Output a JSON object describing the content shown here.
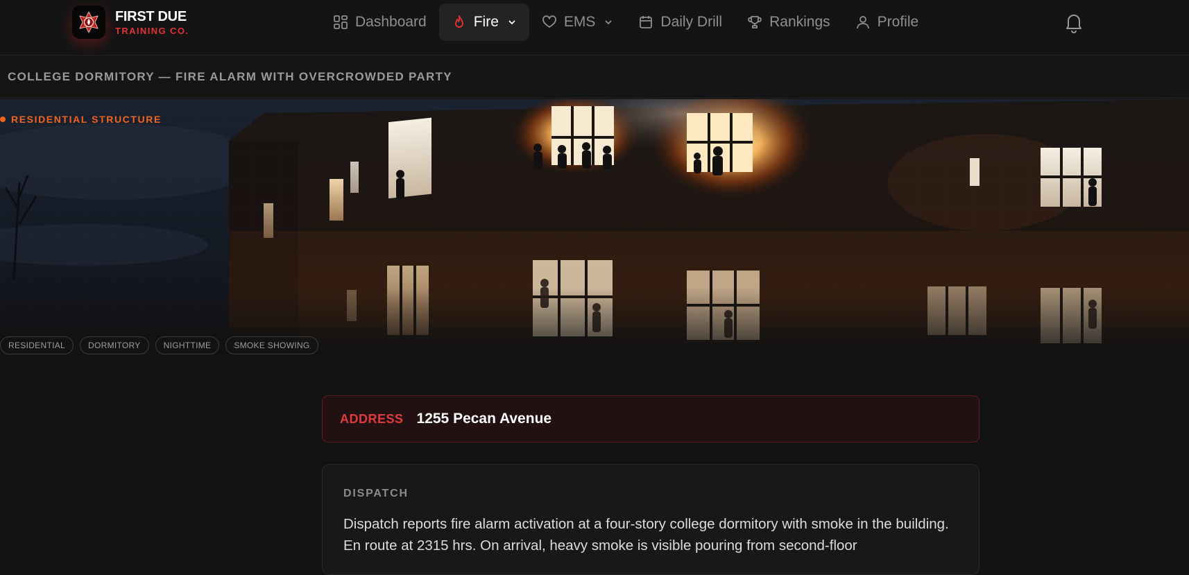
{
  "brand": {
    "line1": "FIRST DUE",
    "line2": "TRAINING CO."
  },
  "nav": [
    {
      "label": "Dashboard",
      "icon": "grid-icon",
      "active": false
    },
    {
      "label": "Fire",
      "icon": "flame-icon",
      "active": true,
      "dropdown": true
    },
    {
      "label": "EMS",
      "icon": "heart-icon",
      "active": false,
      "dropdown": true
    },
    {
      "label": "Daily Drill",
      "icon": "calendar-icon",
      "active": false
    },
    {
      "label": "Rankings",
      "icon": "trophy-icon",
      "active": false
    },
    {
      "label": "Profile",
      "icon": "user-icon",
      "active": false
    }
  ],
  "header": {
    "notifications_icon": "bell-icon"
  },
  "scenario": {
    "title": "COLLEGE DORMITORY — FIRE ALARM WITH OVERCROWDED PARTY",
    "category": "RESIDENTIAL STRUCTURE",
    "tags": [
      "RESIDENTIAL",
      "DORMITORY",
      "NIGHTTIME",
      "SMOKE SHOWING"
    ],
    "address_label": "ADDRESS",
    "address": "1255 Pecan Avenue",
    "dispatch_label": "DISPATCH",
    "dispatch_text": "Dispatch reports fire alarm activation at a four-story college dormitory with smoke in the building. En route at 2315 hrs. On arrival, heavy smoke is visible pouring from second-floor"
  },
  "colors": {
    "accent": "#e23232",
    "category": "#f0641e",
    "background": "#121212"
  }
}
